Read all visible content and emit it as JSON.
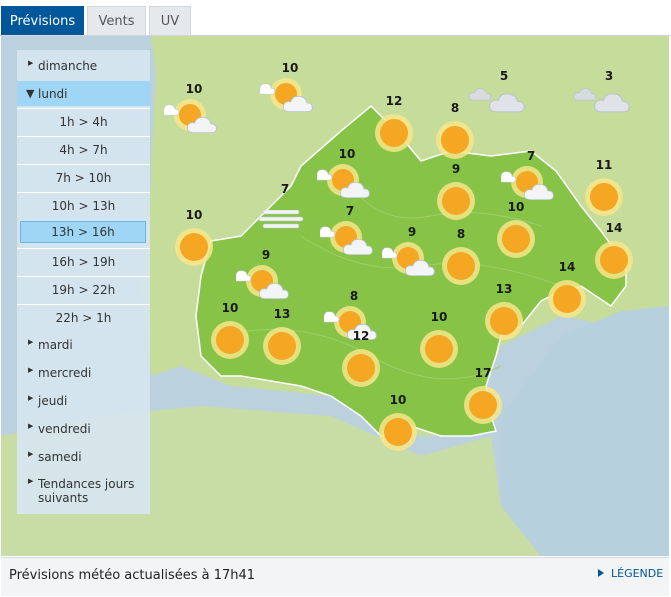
{
  "tabs": [
    {
      "label": "Prévisions",
      "active": true
    },
    {
      "label": "Vents",
      "active": false
    },
    {
      "label": "UV",
      "active": false
    }
  ],
  "sidebar": {
    "days_before": [
      {
        "label": "dimanche"
      }
    ],
    "open_day": {
      "label": "lundi"
    },
    "slots": [
      {
        "label": "1h > 4h"
      },
      {
        "label": "4h > 7h"
      },
      {
        "label": "7h > 10h"
      },
      {
        "label": "10h > 13h"
      },
      {
        "label": "13h > 16h",
        "active": true
      },
      {
        "label": "16h > 19h"
      },
      {
        "label": "19h > 22h"
      },
      {
        "label": "22h > 1h"
      }
    ],
    "days_after": [
      {
        "label": "mardi"
      },
      {
        "label": "mercredi"
      },
      {
        "label": "jeudi"
      },
      {
        "label": "vendredi"
      },
      {
        "label": "samedi"
      },
      {
        "label": "Tendances jours suivants"
      }
    ]
  },
  "forecasts": [
    {
      "temp": "10",
      "icon": "sun-cloud-icon"
    },
    {
      "temp": "10",
      "icon": "sun-cloud-icon"
    },
    {
      "temp": "5",
      "icon": "cloud-icon"
    },
    {
      "temp": "3",
      "icon": "cloud-icon"
    },
    {
      "temp": "12",
      "icon": "sun-icon"
    },
    {
      "temp": "8",
      "icon": "sun-icon"
    },
    {
      "temp": "10",
      "icon": "sun-cloud-icon"
    },
    {
      "temp": "7",
      "icon": "fog-icon"
    },
    {
      "temp": "9",
      "icon": "sun-icon"
    },
    {
      "temp": "7",
      "icon": "sun-cloud-icon"
    },
    {
      "temp": "11",
      "icon": "sun-icon"
    },
    {
      "temp": "10",
      "icon": "sun-icon"
    },
    {
      "temp": "7",
      "icon": "sun-cloud-icon"
    },
    {
      "temp": "9",
      "icon": "sun-cloud-icon"
    },
    {
      "temp": "8",
      "icon": "sun-icon"
    },
    {
      "temp": "10",
      "icon": "sun-icon"
    },
    {
      "temp": "14",
      "icon": "sun-icon"
    },
    {
      "temp": "9",
      "icon": "sun-cloud-icon"
    },
    {
      "temp": "8",
      "icon": "sun-cloud-icon"
    },
    {
      "temp": "14",
      "icon": "sun-icon"
    },
    {
      "temp": "10",
      "icon": "sun-icon"
    },
    {
      "temp": "13",
      "icon": "sun-icon"
    },
    {
      "temp": "13",
      "icon": "sun-icon"
    },
    {
      "temp": "10",
      "icon": "sun-icon"
    },
    {
      "temp": "12",
      "icon": "sun-icon"
    },
    {
      "temp": "17",
      "icon": "sun-icon"
    },
    {
      "temp": "10",
      "icon": "sun-icon"
    }
  ],
  "footer": {
    "update_text": "Prévisions météo actualisées à 17h41",
    "legend_label": "LÉGENDE"
  }
}
